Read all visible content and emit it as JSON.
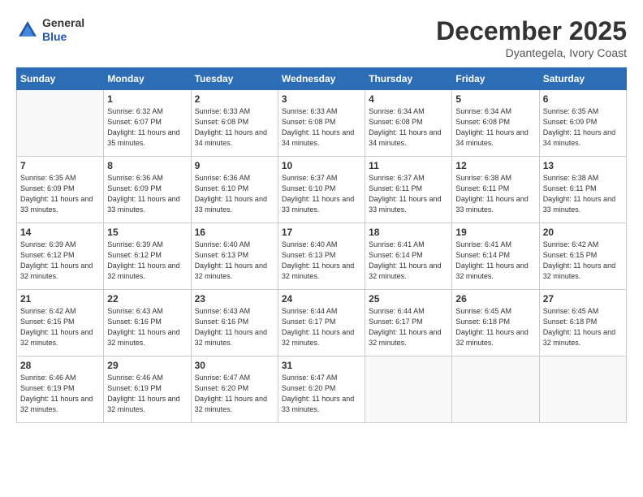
{
  "logo": {
    "general": "General",
    "blue": "Blue"
  },
  "header": {
    "month_title": "December 2025",
    "subtitle": "Dyantegela, Ivory Coast"
  },
  "days_of_week": [
    "Sunday",
    "Monday",
    "Tuesday",
    "Wednesday",
    "Thursday",
    "Friday",
    "Saturday"
  ],
  "weeks": [
    [
      {
        "day": "",
        "sunrise": "",
        "sunset": "",
        "daylight": ""
      },
      {
        "day": "1",
        "sunrise": "Sunrise: 6:32 AM",
        "sunset": "Sunset: 6:07 PM",
        "daylight": "Daylight: 11 hours and 35 minutes."
      },
      {
        "day": "2",
        "sunrise": "Sunrise: 6:33 AM",
        "sunset": "Sunset: 6:08 PM",
        "daylight": "Daylight: 11 hours and 34 minutes."
      },
      {
        "day": "3",
        "sunrise": "Sunrise: 6:33 AM",
        "sunset": "Sunset: 6:08 PM",
        "daylight": "Daylight: 11 hours and 34 minutes."
      },
      {
        "day": "4",
        "sunrise": "Sunrise: 6:34 AM",
        "sunset": "Sunset: 6:08 PM",
        "daylight": "Daylight: 11 hours and 34 minutes."
      },
      {
        "day": "5",
        "sunrise": "Sunrise: 6:34 AM",
        "sunset": "Sunset: 6:08 PM",
        "daylight": "Daylight: 11 hours and 34 minutes."
      },
      {
        "day": "6",
        "sunrise": "Sunrise: 6:35 AM",
        "sunset": "Sunset: 6:09 PM",
        "daylight": "Daylight: 11 hours and 34 minutes."
      }
    ],
    [
      {
        "day": "7",
        "sunrise": "Sunrise: 6:35 AM",
        "sunset": "Sunset: 6:09 PM",
        "daylight": "Daylight: 11 hours and 33 minutes."
      },
      {
        "day": "8",
        "sunrise": "Sunrise: 6:36 AM",
        "sunset": "Sunset: 6:09 PM",
        "daylight": "Daylight: 11 hours and 33 minutes."
      },
      {
        "day": "9",
        "sunrise": "Sunrise: 6:36 AM",
        "sunset": "Sunset: 6:10 PM",
        "daylight": "Daylight: 11 hours and 33 minutes."
      },
      {
        "day": "10",
        "sunrise": "Sunrise: 6:37 AM",
        "sunset": "Sunset: 6:10 PM",
        "daylight": "Daylight: 11 hours and 33 minutes."
      },
      {
        "day": "11",
        "sunrise": "Sunrise: 6:37 AM",
        "sunset": "Sunset: 6:11 PM",
        "daylight": "Daylight: 11 hours and 33 minutes."
      },
      {
        "day": "12",
        "sunrise": "Sunrise: 6:38 AM",
        "sunset": "Sunset: 6:11 PM",
        "daylight": "Daylight: 11 hours and 33 minutes."
      },
      {
        "day": "13",
        "sunrise": "Sunrise: 6:38 AM",
        "sunset": "Sunset: 6:11 PM",
        "daylight": "Daylight: 11 hours and 33 minutes."
      }
    ],
    [
      {
        "day": "14",
        "sunrise": "Sunrise: 6:39 AM",
        "sunset": "Sunset: 6:12 PM",
        "daylight": "Daylight: 11 hours and 32 minutes."
      },
      {
        "day": "15",
        "sunrise": "Sunrise: 6:39 AM",
        "sunset": "Sunset: 6:12 PM",
        "daylight": "Daylight: 11 hours and 32 minutes."
      },
      {
        "day": "16",
        "sunrise": "Sunrise: 6:40 AM",
        "sunset": "Sunset: 6:13 PM",
        "daylight": "Daylight: 11 hours and 32 minutes."
      },
      {
        "day": "17",
        "sunrise": "Sunrise: 6:40 AM",
        "sunset": "Sunset: 6:13 PM",
        "daylight": "Daylight: 11 hours and 32 minutes."
      },
      {
        "day": "18",
        "sunrise": "Sunrise: 6:41 AM",
        "sunset": "Sunset: 6:14 PM",
        "daylight": "Daylight: 11 hours and 32 minutes."
      },
      {
        "day": "19",
        "sunrise": "Sunrise: 6:41 AM",
        "sunset": "Sunset: 6:14 PM",
        "daylight": "Daylight: 11 hours and 32 minutes."
      },
      {
        "day": "20",
        "sunrise": "Sunrise: 6:42 AM",
        "sunset": "Sunset: 6:15 PM",
        "daylight": "Daylight: 11 hours and 32 minutes."
      }
    ],
    [
      {
        "day": "21",
        "sunrise": "Sunrise: 6:42 AM",
        "sunset": "Sunset: 6:15 PM",
        "daylight": "Daylight: 11 hours and 32 minutes."
      },
      {
        "day": "22",
        "sunrise": "Sunrise: 6:43 AM",
        "sunset": "Sunset: 6:16 PM",
        "daylight": "Daylight: 11 hours and 32 minutes."
      },
      {
        "day": "23",
        "sunrise": "Sunrise: 6:43 AM",
        "sunset": "Sunset: 6:16 PM",
        "daylight": "Daylight: 11 hours and 32 minutes."
      },
      {
        "day": "24",
        "sunrise": "Sunrise: 6:44 AM",
        "sunset": "Sunset: 6:17 PM",
        "daylight": "Daylight: 11 hours and 32 minutes."
      },
      {
        "day": "25",
        "sunrise": "Sunrise: 6:44 AM",
        "sunset": "Sunset: 6:17 PM",
        "daylight": "Daylight: 11 hours and 32 minutes."
      },
      {
        "day": "26",
        "sunrise": "Sunrise: 6:45 AM",
        "sunset": "Sunset: 6:18 PM",
        "daylight": "Daylight: 11 hours and 32 minutes."
      },
      {
        "day": "27",
        "sunrise": "Sunrise: 6:45 AM",
        "sunset": "Sunset: 6:18 PM",
        "daylight": "Daylight: 11 hours and 32 minutes."
      }
    ],
    [
      {
        "day": "28",
        "sunrise": "Sunrise: 6:46 AM",
        "sunset": "Sunset: 6:19 PM",
        "daylight": "Daylight: 11 hours and 32 minutes."
      },
      {
        "day": "29",
        "sunrise": "Sunrise: 6:46 AM",
        "sunset": "Sunset: 6:19 PM",
        "daylight": "Daylight: 11 hours and 32 minutes."
      },
      {
        "day": "30",
        "sunrise": "Sunrise: 6:47 AM",
        "sunset": "Sunset: 6:20 PM",
        "daylight": "Daylight: 11 hours and 32 minutes."
      },
      {
        "day": "31",
        "sunrise": "Sunrise: 6:47 AM",
        "sunset": "Sunset: 6:20 PM",
        "daylight": "Daylight: 11 hours and 33 minutes."
      },
      {
        "day": "",
        "sunrise": "",
        "sunset": "",
        "daylight": ""
      },
      {
        "day": "",
        "sunrise": "",
        "sunset": "",
        "daylight": ""
      },
      {
        "day": "",
        "sunrise": "",
        "sunset": "",
        "daylight": ""
      }
    ]
  ]
}
